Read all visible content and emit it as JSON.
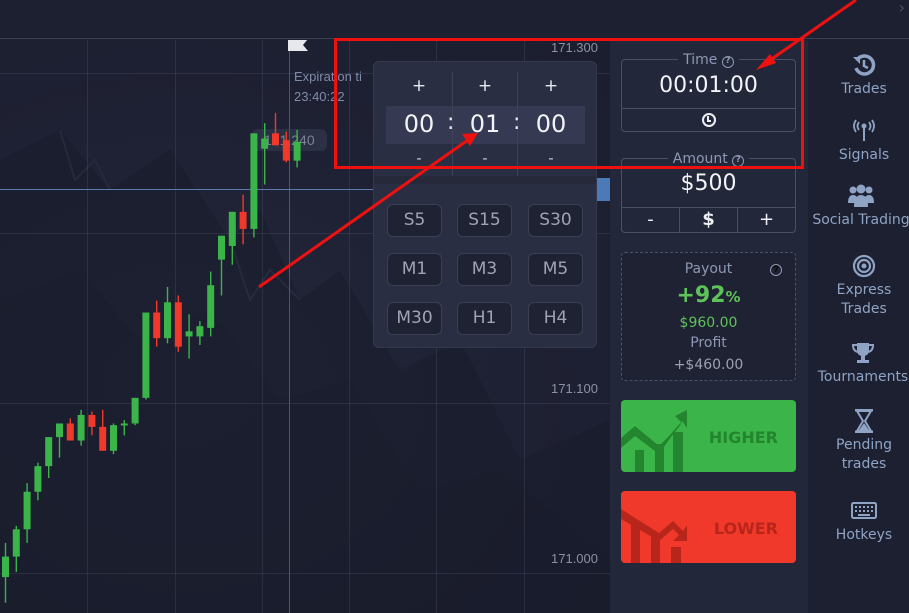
{
  "chart": {
    "price_labels": [
      "171.300",
      "171.100",
      "171.000"
    ],
    "hover_price": "171.240",
    "expiration": {
      "label": "Expiration ti",
      "time": "23:40:22"
    },
    "colors": {
      "bull": "#3bb54a",
      "bear": "#f0392b"
    },
    "candles": [
      {
        "o": 170.99,
        "h": 171.01,
        "l": 170.975,
        "c": 171.002,
        "dir": "up"
      },
      {
        "o": 171.002,
        "h": 171.02,
        "l": 170.993,
        "c": 171.018,
        "dir": "up"
      },
      {
        "o": 171.018,
        "h": 171.045,
        "l": 171.01,
        "c": 171.04,
        "dir": "up"
      },
      {
        "o": 171.04,
        "h": 171.057,
        "l": 171.035,
        "c": 171.055,
        "dir": "up"
      },
      {
        "o": 171.055,
        "h": 171.07,
        "l": 171.048,
        "c": 171.072,
        "dir": "up"
      },
      {
        "o": 171.072,
        "h": 171.075,
        "l": 171.06,
        "c": 171.08,
        "dir": "up"
      },
      {
        "o": 171.08,
        "h": 171.083,
        "l": 171.077,
        "c": 171.07,
        "dir": "down"
      },
      {
        "o": 171.07,
        "h": 171.088,
        "l": 171.067,
        "c": 171.085,
        "dir": "up"
      },
      {
        "o": 171.085,
        "h": 171.087,
        "l": 171.073,
        "c": 171.078,
        "dir": "down"
      },
      {
        "o": 171.078,
        "h": 171.088,
        "l": 171.066,
        "c": 171.064,
        "dir": "down"
      },
      {
        "o": 171.064,
        "h": 171.08,
        "l": 171.062,
        "c": 171.079,
        "dir": "up"
      },
      {
        "o": 171.079,
        "h": 171.082,
        "l": 171.073,
        "c": 171.08,
        "dir": "up"
      },
      {
        "o": 171.08,
        "h": 171.08,
        "l": 171.079,
        "c": 171.095,
        "dir": "up"
      },
      {
        "o": 171.095,
        "h": 171.1,
        "l": 171.094,
        "c": 171.145,
        "dir": "up"
      },
      {
        "o": 171.145,
        "h": 171.152,
        "l": 171.125,
        "c": 171.13,
        "dir": "down"
      },
      {
        "o": 171.13,
        "h": 171.16,
        "l": 171.127,
        "c": 171.151,
        "dir": "up"
      },
      {
        "o": 171.151,
        "h": 171.155,
        "l": 171.122,
        "c": 171.125,
        "dir": "down"
      },
      {
        "o": 171.131,
        "h": 171.144,
        "l": 171.118,
        "c": 171.134,
        "dir": "up"
      },
      {
        "o": 171.131,
        "h": 171.14,
        "l": 171.126,
        "c": 171.137,
        "dir": "up"
      },
      {
        "o": 171.136,
        "h": 171.169,
        "l": 171.131,
        "c": 171.161,
        "dir": "up"
      },
      {
        "o": 171.176,
        "h": 171.181,
        "l": 171.155,
        "c": 171.19,
        "dir": "up"
      },
      {
        "o": 171.184,
        "h": 171.199,
        "l": 171.173,
        "c": 171.204,
        "dir": "up"
      },
      {
        "o": 171.204,
        "h": 171.214,
        "l": 171.185,
        "c": 171.194,
        "dir": "down"
      },
      {
        "o": 171.194,
        "h": 171.236,
        "l": 171.189,
        "c": 171.25,
        "dir": "up"
      },
      {
        "o": 171.241,
        "h": 171.256,
        "l": 171.22,
        "c": 171.247,
        "dir": "up"
      },
      {
        "o": 171.25,
        "h": 171.262,
        "l": 171.245,
        "c": 171.243,
        "dir": "down"
      },
      {
        "o": 171.246,
        "h": 171.251,
        "l": 171.233,
        "c": 171.234,
        "dir": "down"
      },
      {
        "o": 171.234,
        "h": 171.252,
        "l": 171.23,
        "c": 171.245,
        "dir": "up"
      }
    ]
  },
  "timer_popup": {
    "plus": "+",
    "minus": "-",
    "separator": ":",
    "hours": "00",
    "minutes": "01",
    "seconds": "00",
    "presets": [
      "S5",
      "S15",
      "S30",
      "M1",
      "M3",
      "M5",
      "M30",
      "H1",
      "H4"
    ]
  },
  "panel": {
    "time": {
      "label": "Time",
      "value": "00:01:00",
      "help_icon": "question-circle-icon",
      "footer_icon": "clock-icon"
    },
    "amount": {
      "label": "Amount",
      "value": "$500",
      "minus": "-",
      "currency": "$",
      "plus": "+"
    },
    "payout": {
      "label": "Payout",
      "percent": "+92",
      "percent_sign": "%",
      "amount": "$960.00",
      "profit_label": "Profit",
      "profit": "+$460.00"
    },
    "higher_label": "HIGHER",
    "lower_label": "LOWER"
  },
  "sidebar": {
    "items": [
      {
        "label": "Trades",
        "icon": "history-icon"
      },
      {
        "label": "Signals",
        "icon": "antenna-icon"
      },
      {
        "label": "Social Trading",
        "icon": "users-icon"
      },
      {
        "label": "Express Trades",
        "icon": "target-icon"
      },
      {
        "label": "Tournaments",
        "icon": "trophy-icon"
      },
      {
        "label": "Pending trades",
        "icon": "hourglass-icon"
      },
      {
        "label": "Hotkeys",
        "icon": "keyboard-icon"
      }
    ]
  },
  "top_bar": {
    "chevron": "›"
  },
  "colors": {
    "annotation": "#ef1010",
    "accent_green": "#5ec25a",
    "higher": "#3bb54a",
    "lower": "#f0392b"
  }
}
